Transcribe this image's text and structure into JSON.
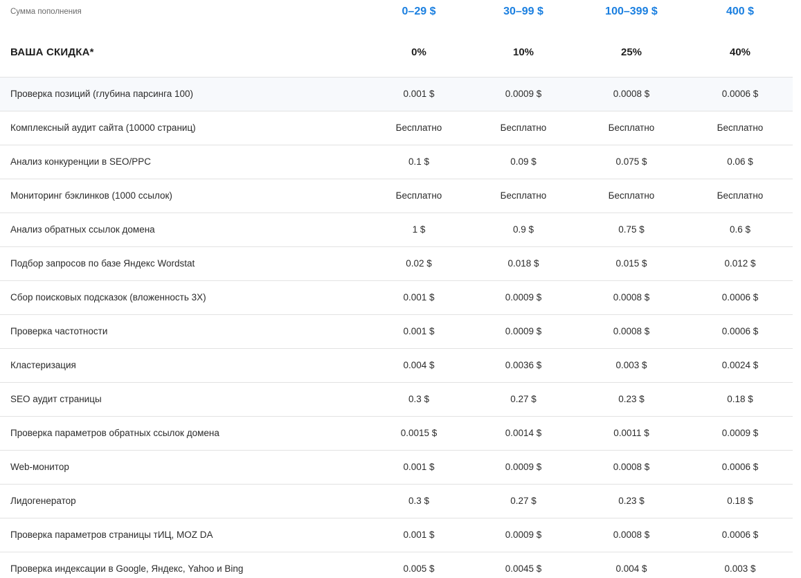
{
  "header": {
    "amount_label": "Сумма пополнения",
    "amounts": [
      "0–29 $",
      "30–99 $",
      "100–399 $",
      "400 $"
    ],
    "discount_label": "ВАША СКИДКА*",
    "discounts": [
      "0%",
      "10%",
      "25%",
      "40%"
    ]
  },
  "rows": [
    {
      "label": "Проверка позиций (глубина парсинга 100)",
      "values": [
        "0.001 $",
        "0.0009 $",
        "0.0008 $",
        "0.0006 $"
      ]
    },
    {
      "label": "Комплексный аудит сайта (10000 страниц)",
      "values": [
        "Бесплатно",
        "Бесплатно",
        "Бесплатно",
        "Бесплатно"
      ]
    },
    {
      "label": "Анализ конкуренции в SEO/PPC",
      "values": [
        "0.1 $",
        "0.09 $",
        "0.075 $",
        "0.06 $"
      ]
    },
    {
      "label": "Мониторинг бэклинков (1000 ссылок)",
      "values": [
        "Бесплатно",
        "Бесплатно",
        "Бесплатно",
        "Бесплатно"
      ]
    },
    {
      "label": "Анализ обратных ссылок домена",
      "values": [
        "1 $",
        "0.9 $",
        "0.75 $",
        "0.6 $"
      ]
    },
    {
      "label": "Подбор запросов по базе Яндекс Wordstat",
      "values": [
        "0.02 $",
        "0.018 $",
        "0.015 $",
        "0.012 $"
      ]
    },
    {
      "label": "Сбор поисковых подсказок (вложенность 3X)",
      "values": [
        "0.001 $",
        "0.0009 $",
        "0.0008 $",
        "0.0006 $"
      ]
    },
    {
      "label": "Проверка частотности",
      "values": [
        "0.001 $",
        "0.0009 $",
        "0.0008 $",
        "0.0006 $"
      ]
    },
    {
      "label": "Кластеризация",
      "values": [
        "0.004 $",
        "0.0036 $",
        "0.003 $",
        "0.0024 $"
      ]
    },
    {
      "label": "SEO аудит страницы",
      "values": [
        "0.3 $",
        "0.27 $",
        "0.23 $",
        "0.18 $"
      ]
    },
    {
      "label": "Проверка параметров обратных ссылок домена",
      "values": [
        "0.0015 $",
        "0.0014 $",
        "0.0011 $",
        "0.0009 $"
      ]
    },
    {
      "label": "Web-монитор",
      "values": [
        "0.001 $",
        "0.0009 $",
        "0.0008 $",
        "0.0006 $"
      ]
    },
    {
      "label": "Лидогенератор",
      "values": [
        "0.3 $",
        "0.27 $",
        "0.23 $",
        "0.18 $"
      ]
    },
    {
      "label": "Проверка параметров страницы тИЦ, MOZ DA",
      "values": [
        "0.001 $",
        "0.0009 $",
        "0.0008 $",
        "0.0006 $"
      ]
    },
    {
      "label": "Проверка индексации в Google, Яндекс, Yahoo и Bing",
      "values": [
        "0.005 $",
        "0.0045 $",
        "0.004 $",
        "0.003 $"
      ]
    }
  ],
  "colors": {
    "accent": "#1a7fe0",
    "row_highlight": "#f7f9fc",
    "divider": "#e2e2e2"
  }
}
